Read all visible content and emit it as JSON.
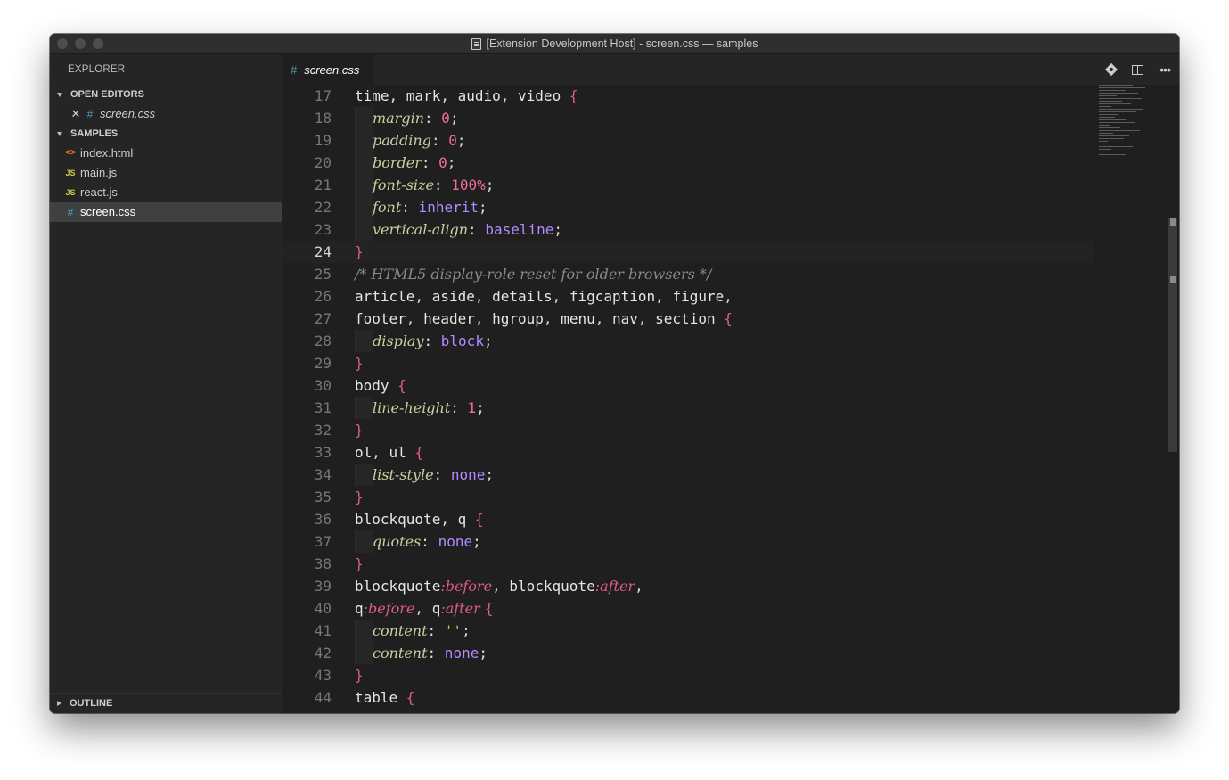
{
  "window": {
    "title": "[Extension Development Host] - screen.css — samples"
  },
  "sidebar": {
    "header": "EXPLORER",
    "open_editors": {
      "label": "OPEN EDITORS",
      "items": [
        {
          "name": "screen.css",
          "icon": "#"
        }
      ]
    },
    "samples": {
      "label": "SAMPLES",
      "items": [
        {
          "name": "index.html",
          "icon": "<>"
        },
        {
          "name": "main.js",
          "icon": "JS"
        },
        {
          "name": "react.js",
          "icon": "JS"
        },
        {
          "name": "screen.css",
          "icon": "#"
        }
      ]
    },
    "outline": {
      "label": "OUTLINE"
    }
  },
  "editor": {
    "tab": {
      "label": "screen.css",
      "icon": "#"
    },
    "actions": [
      "git-icon",
      "split-editor-icon",
      "more-icon"
    ],
    "current_line": "24",
    "lines": [
      {
        "n": "17",
        "tokens": [
          [
            "t-plain",
            "time"
          ],
          [
            "t-punct",
            ", "
          ],
          [
            "t-plain",
            "mark"
          ],
          [
            "t-punct",
            ", "
          ],
          [
            "t-plain",
            "audio"
          ],
          [
            "t-punct",
            ", "
          ],
          [
            "t-plain",
            "video "
          ],
          [
            "t-brace",
            "{"
          ]
        ]
      },
      {
        "n": "18",
        "indent": 1,
        "tokens": [
          [
            "t-prop",
            "margin"
          ],
          [
            "t-punct",
            ": "
          ],
          [
            "t-num",
            "0"
          ],
          [
            "t-punct",
            ";"
          ]
        ]
      },
      {
        "n": "19",
        "indent": 1,
        "tokens": [
          [
            "t-prop",
            "padding"
          ],
          [
            "t-punct",
            ": "
          ],
          [
            "t-num",
            "0"
          ],
          [
            "t-punct",
            ";"
          ]
        ]
      },
      {
        "n": "20",
        "indent": 1,
        "tokens": [
          [
            "t-prop",
            "border"
          ],
          [
            "t-punct",
            ": "
          ],
          [
            "t-num",
            "0"
          ],
          [
            "t-punct",
            ";"
          ]
        ]
      },
      {
        "n": "21",
        "indent": 1,
        "tokens": [
          [
            "t-prop",
            "font-size"
          ],
          [
            "t-punct",
            ": "
          ],
          [
            "t-num",
            "100%"
          ],
          [
            "t-punct",
            ";"
          ]
        ]
      },
      {
        "n": "22",
        "indent": 1,
        "tokens": [
          [
            "t-prop",
            "font"
          ],
          [
            "t-punct",
            ": "
          ],
          [
            "t-val",
            "inherit"
          ],
          [
            "t-punct",
            ";"
          ]
        ]
      },
      {
        "n": "23",
        "indent": 1,
        "tokens": [
          [
            "t-prop",
            "vertical-align"
          ],
          [
            "t-punct",
            ": "
          ],
          [
            "t-val",
            "baseline"
          ],
          [
            "t-punct",
            ";"
          ]
        ]
      },
      {
        "n": "24",
        "tokens": [
          [
            "t-brace",
            "}"
          ]
        ]
      },
      {
        "n": "25",
        "tokens": [
          [
            "t-comment",
            "/* HTML5 display-role reset for older browsers */"
          ]
        ]
      },
      {
        "n": "26",
        "tokens": [
          [
            "t-plain",
            "article"
          ],
          [
            "t-punct",
            ", "
          ],
          [
            "t-plain",
            "aside"
          ],
          [
            "t-punct",
            ", "
          ],
          [
            "t-plain",
            "details"
          ],
          [
            "t-punct",
            ", "
          ],
          [
            "t-plain",
            "figcaption"
          ],
          [
            "t-punct",
            ", "
          ],
          [
            "t-plain",
            "figure"
          ],
          [
            "t-punct",
            ","
          ]
        ]
      },
      {
        "n": "27",
        "tokens": [
          [
            "t-plain",
            "footer"
          ],
          [
            "t-punct",
            ", "
          ],
          [
            "t-plain",
            "header"
          ],
          [
            "t-punct",
            ", "
          ],
          [
            "t-plain",
            "hgroup"
          ],
          [
            "t-punct",
            ", "
          ],
          [
            "t-plain",
            "menu"
          ],
          [
            "t-punct",
            ", "
          ],
          [
            "t-plain",
            "nav"
          ],
          [
            "t-punct",
            ", "
          ],
          [
            "t-plain",
            "section "
          ],
          [
            "t-brace",
            "{"
          ]
        ]
      },
      {
        "n": "28",
        "indent": 1,
        "tokens": [
          [
            "t-prop",
            "display"
          ],
          [
            "t-punct",
            ": "
          ],
          [
            "t-val",
            "block"
          ],
          [
            "t-punct",
            ";"
          ]
        ]
      },
      {
        "n": "29",
        "tokens": [
          [
            "t-brace",
            "}"
          ]
        ]
      },
      {
        "n": "30",
        "tokens": [
          [
            "t-plain",
            "body "
          ],
          [
            "t-brace",
            "{"
          ]
        ]
      },
      {
        "n": "31",
        "indent": 1,
        "tokens": [
          [
            "t-prop",
            "line-height"
          ],
          [
            "t-punct",
            ": "
          ],
          [
            "t-num",
            "1"
          ],
          [
            "t-punct",
            ";"
          ]
        ]
      },
      {
        "n": "32",
        "tokens": [
          [
            "t-brace",
            "}"
          ]
        ]
      },
      {
        "n": "33",
        "tokens": [
          [
            "t-plain",
            "ol"
          ],
          [
            "t-punct",
            ", "
          ],
          [
            "t-plain",
            "ul "
          ],
          [
            "t-brace",
            "{"
          ]
        ]
      },
      {
        "n": "34",
        "indent": 1,
        "tokens": [
          [
            "t-prop",
            "list-style"
          ],
          [
            "t-punct",
            ": "
          ],
          [
            "t-val",
            "none"
          ],
          [
            "t-punct",
            ";"
          ]
        ]
      },
      {
        "n": "35",
        "tokens": [
          [
            "t-brace",
            "}"
          ]
        ]
      },
      {
        "n": "36",
        "tokens": [
          [
            "t-plain",
            "blockquote"
          ],
          [
            "t-punct",
            ", "
          ],
          [
            "t-plain",
            "q "
          ],
          [
            "t-brace",
            "{"
          ]
        ]
      },
      {
        "n": "37",
        "indent": 1,
        "tokens": [
          [
            "t-prop",
            "quotes"
          ],
          [
            "t-punct",
            ": "
          ],
          [
            "t-val",
            "none"
          ],
          [
            "t-punct",
            ";"
          ]
        ]
      },
      {
        "n": "38",
        "tokens": [
          [
            "t-brace",
            "}"
          ]
        ]
      },
      {
        "n": "39",
        "tokens": [
          [
            "t-plain",
            "blockquote"
          ],
          [
            "t-pseudo",
            ":before"
          ],
          [
            "t-punct",
            ", "
          ],
          [
            "t-plain",
            "blockquote"
          ],
          [
            "t-pseudo",
            ":after"
          ],
          [
            "t-punct",
            ","
          ]
        ]
      },
      {
        "n": "40",
        "tokens": [
          [
            "t-plain",
            "q"
          ],
          [
            "t-pseudo",
            ":before"
          ],
          [
            "t-punct",
            ", "
          ],
          [
            "t-plain",
            "q"
          ],
          [
            "t-pseudo",
            ":after "
          ],
          [
            "t-brace",
            "{"
          ]
        ]
      },
      {
        "n": "41",
        "indent": 1,
        "tokens": [
          [
            "t-prop",
            "content"
          ],
          [
            "t-punct",
            ": "
          ],
          [
            "t-str",
            "''"
          ],
          [
            "t-punct",
            ";"
          ]
        ]
      },
      {
        "n": "42",
        "indent": 1,
        "tokens": [
          [
            "t-prop",
            "content"
          ],
          [
            "t-punct",
            ": "
          ],
          [
            "t-val",
            "none"
          ],
          [
            "t-punct",
            ";"
          ]
        ]
      },
      {
        "n": "43",
        "tokens": [
          [
            "t-brace",
            "}"
          ]
        ]
      },
      {
        "n": "44",
        "tokens": [
          [
            "t-plain",
            "table "
          ],
          [
            "t-brace",
            "{"
          ]
        ]
      }
    ]
  }
}
